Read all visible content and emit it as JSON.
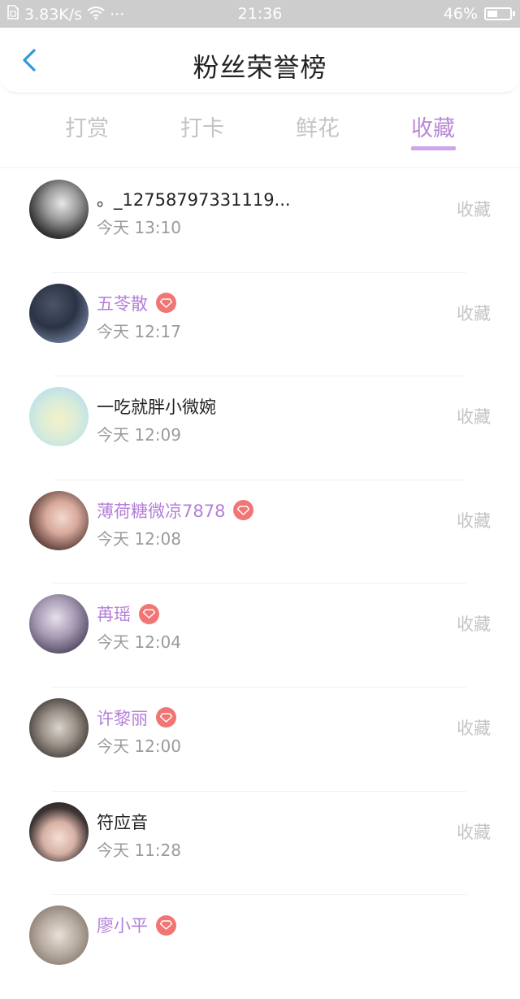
{
  "status_bar": {
    "speed": "3.83K/s",
    "dots": "···",
    "time": "21:36",
    "battery": "46%",
    "battery_level": 0.46
  },
  "header": {
    "title": "粉丝荣誉榜"
  },
  "tabs": [
    {
      "label": "打赏",
      "active": false
    },
    {
      "label": "打卡",
      "active": false
    },
    {
      "label": "鲜花",
      "active": false
    },
    {
      "label": "收藏",
      "active": true
    }
  ],
  "rows": [
    {
      "name": "。_12758797331119...",
      "time": "今天 13:10",
      "action": "收藏",
      "vip": false
    },
    {
      "name": "五苓散",
      "time": "今天 12:17",
      "action": "收藏",
      "vip": true
    },
    {
      "name": "一吃就胖小微婉",
      "time": "今天 12:09",
      "action": "收藏",
      "vip": false
    },
    {
      "name": "薄荷糖微凉7878",
      "time": "今天 12:08",
      "action": "收藏",
      "vip": true
    },
    {
      "name": "苒瑶",
      "time": "今天 12:04",
      "action": "收藏",
      "vip": true
    },
    {
      "name": "许黎丽",
      "time": "今天 12:00",
      "action": "收藏",
      "vip": true
    },
    {
      "name": "符应音",
      "time": "今天 11:28",
      "action": "收藏",
      "vip": false
    },
    {
      "name": "廖小平",
      "time": "",
      "action": "",
      "vip": true
    }
  ],
  "colors": {
    "accent": "#b98ad6",
    "vip_name": "#b47fd8",
    "badge": "#f27575",
    "back_arrow": "#2f98e0"
  }
}
